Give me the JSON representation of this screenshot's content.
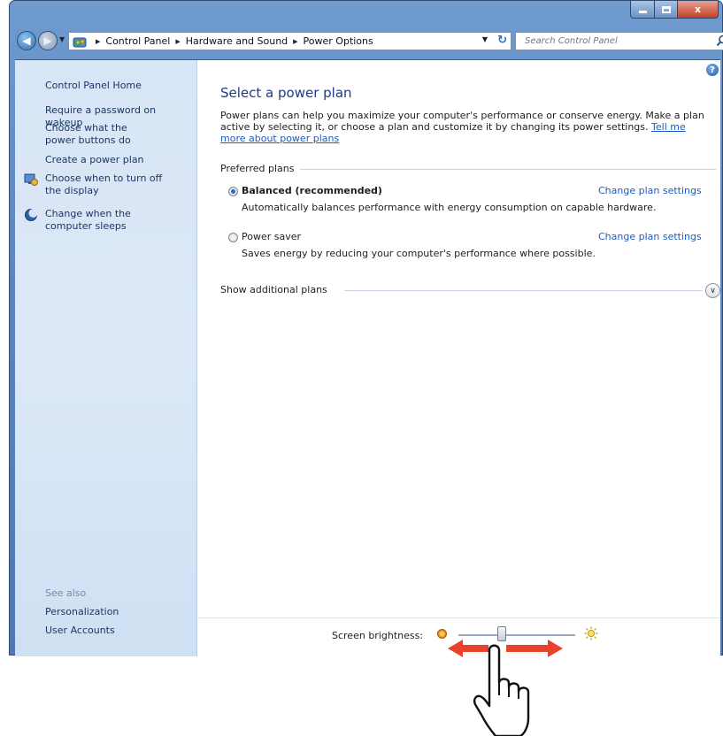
{
  "window": {
    "controls": {
      "minimize": "",
      "maximize": "",
      "close": "x"
    }
  },
  "address_bar": {
    "crumbs": [
      "Control Panel",
      "Hardware and Sound",
      "Power Options"
    ]
  },
  "search": {
    "placeholder": "Search Control Panel"
  },
  "sidebar": {
    "home": "Control Panel Home",
    "links": [
      "Require a password on wakeup",
      "Choose what the power buttons do",
      "Create a power plan",
      "Choose when to turn off the display",
      "Change when the computer sleeps"
    ],
    "see_also_title": "See also",
    "see_also": [
      "Personalization",
      "User Accounts"
    ]
  },
  "main": {
    "title": "Select a power plan",
    "description": "Power plans can help you maximize your computer's performance or conserve energy. Make a plan active by selecting it, or choose a plan and customize it by changing its power settings. ",
    "description_link": "Tell me more about power plans",
    "preferred_plans_label": "Preferred plans",
    "plans": [
      {
        "name": "Balanced (recommended)",
        "description": "Automatically balances performance with energy consumption on capable hardware.",
        "link": "Change plan settings",
        "selected": true
      },
      {
        "name": "Power saver",
        "description": "Saves energy by reducing your computer's performance where possible.",
        "link": "Change plan settings",
        "selected": false
      }
    ],
    "show_additional_label": "Show additional plans",
    "brightness_label": "Screen brightness:",
    "brightness_level": 0.37
  },
  "colors": {
    "title_blue": "#1e3a87",
    "link_blue": "#1a5cc4",
    "sidebar_bg": "#d8e5f6",
    "arrow_red": "#e8412c"
  }
}
